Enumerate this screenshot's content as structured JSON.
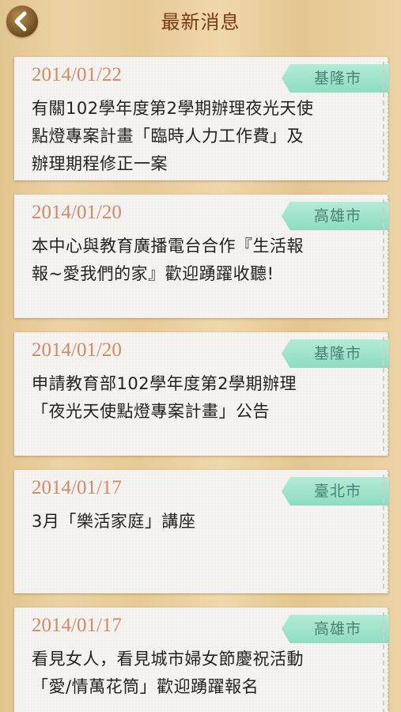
{
  "header": {
    "title": "最新消息",
    "back_icon": "chevron-left-icon"
  },
  "news": [
    {
      "date": "2014/01/22",
      "city": "基隆市",
      "lines": [
        "有關102學年度第2學期辦理夜光天使",
        "點燈專案計畫「臨時人力工作費」及",
        "辦理期程修正一案"
      ]
    },
    {
      "date": "2014/01/20",
      "city": "高雄市",
      "lines": [
        "本中心與教育廣播電台合作『生活報",
        "報~愛我們的家』歡迎踴躍收聽!"
      ]
    },
    {
      "date": "2014/01/20",
      "city": "基隆市",
      "lines": [
        "申請教育部102學年度第2學期辦理",
        "「夜光天使點燈專案計畫」公告"
      ]
    },
    {
      "date": "2014/01/17",
      "city": "臺北市",
      "lines": [
        "3月「樂活家庭」講座"
      ]
    },
    {
      "date": "2014/01/17",
      "city": "高雄市",
      "lines": [
        "看見女人，看見城市婦女節慶祝活動",
        "「愛/情萬花筒」歡迎踴躍報名"
      ]
    }
  ],
  "colors": {
    "title": "#7a3a14",
    "date": "#d08a6a",
    "tag_bg": "#a0e3cc",
    "tag_text": "#4a8074"
  }
}
